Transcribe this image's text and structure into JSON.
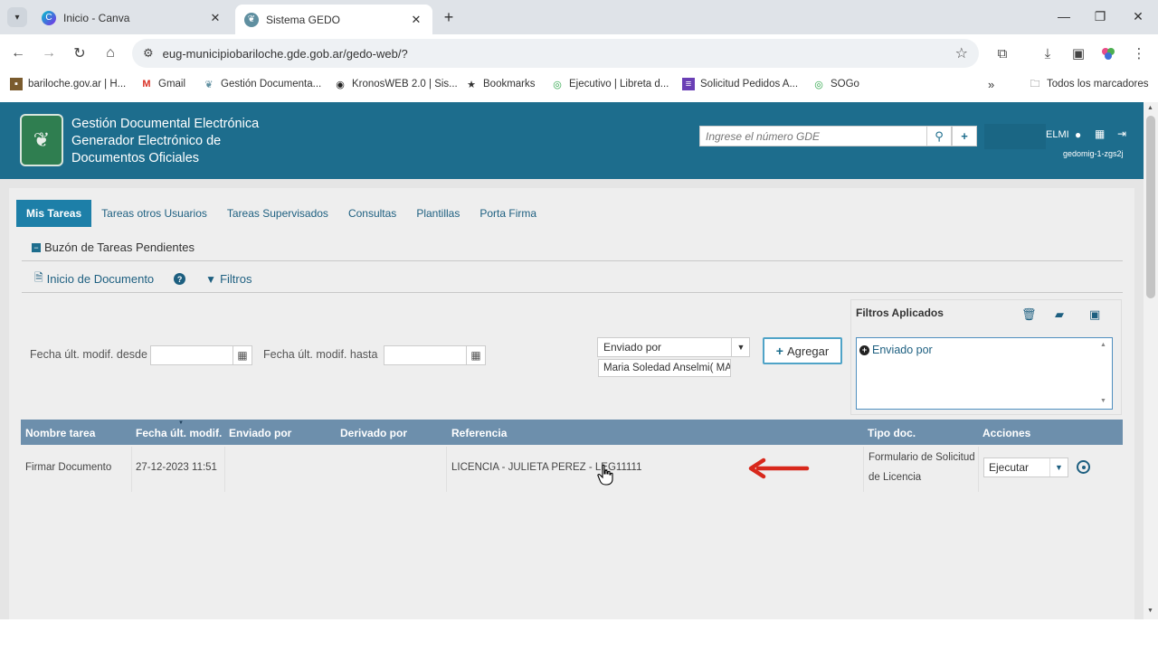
{
  "browser": {
    "tabs": [
      {
        "title": "Inicio - Canva",
        "icon": "canva-icon"
      },
      {
        "title": "Sistema GEDO",
        "icon": "gedo-icon"
      }
    ],
    "url": "eug-municipiobariloche.gde.gob.ar/gedo-web/?",
    "bookmarks": [
      {
        "label": "bariloche.gov.ar | H...",
        "icon": "bariloche-icon"
      },
      {
        "label": "Gmail",
        "icon": "gmail-icon"
      },
      {
        "label": "Gestión Documenta...",
        "icon": "gde-icon"
      },
      {
        "label": "KronosWEB 2.0 | Sis...",
        "icon": "kronos-icon"
      },
      {
        "label": "Bookmarks",
        "icon": "star-icon"
      },
      {
        "label": "Ejecutivo | Libreta d...",
        "icon": "ejecutivo-icon"
      },
      {
        "label": "Solicitud Pedidos A...",
        "icon": "form-icon"
      },
      {
        "label": "SOGo",
        "icon": "sogo-icon"
      }
    ],
    "all_bookmarks_label": "Todos los marcadores"
  },
  "header": {
    "title_line1": "Gestión Documental Electrónica",
    "title_line2": "Generador Electrónico de",
    "title_line3": "Documentos Oficiales",
    "search_placeholder": "Ingrese el número GDE",
    "user_partial": "ELMI",
    "server_id": "gedomig-1-zgs2j"
  },
  "main_tabs": [
    {
      "label": "Mis Tareas",
      "active": true
    },
    {
      "label": "Tareas otros Usuarios"
    },
    {
      "label": "Tareas Supervisados"
    },
    {
      "label": "Consultas"
    },
    {
      "label": "Plantillas"
    },
    {
      "label": "Porta Firma"
    }
  ],
  "section": {
    "title": "Buzón de Tareas Pendientes",
    "actions": {
      "inicio": "Inicio de Documento",
      "filtros": "Filtros"
    }
  },
  "filters": {
    "desde_label": "Fecha últ. modif. desde",
    "hasta_label": "Fecha últ. modif. hasta",
    "selected_field": "Enviado por",
    "selected_value": "Maria Soledad Anselmi( MA",
    "add_label": "Agregar",
    "applied_title": "Filtros Aplicados",
    "applied_items": [
      "Enviado por"
    ]
  },
  "table": {
    "columns": [
      "Nombre tarea",
      "Fecha últ. modif.",
      "Enviado por",
      "Derivado por",
      "Referencia",
      "Tipo doc.",
      "Acciones"
    ],
    "rows": [
      {
        "nombre": "Firmar Documento",
        "fecha": "27-12-2023 11:51",
        "enviado": "",
        "derivado": "",
        "referencia": "LICENCIA - JULIETA PEREZ - LEG11111",
        "tipo_line1": "Formulario de Solicitud",
        "tipo_line2": "de Licencia",
        "accion": "Ejecutar"
      }
    ]
  },
  "colors": {
    "header_bg": "#1d6d8d",
    "active_tab": "#1d7fa8",
    "table_header": "#6d8fac",
    "annotation_arrow": "#d8281c"
  }
}
